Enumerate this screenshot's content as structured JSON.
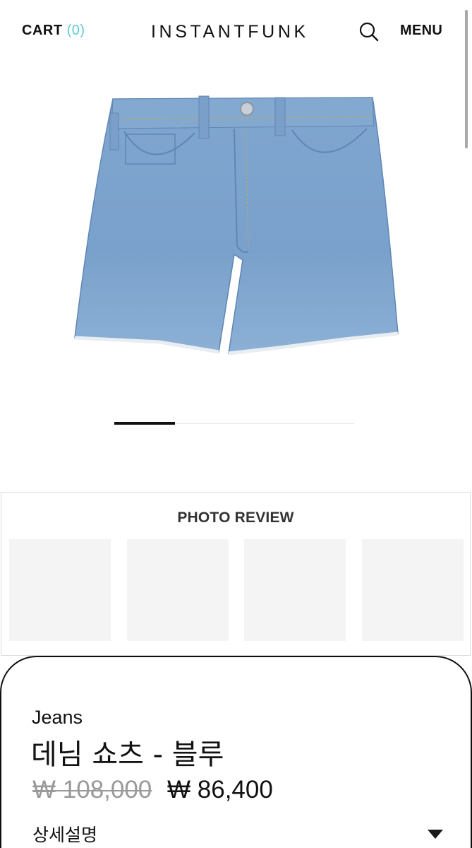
{
  "header": {
    "cart_label": "CART",
    "cart_count": "(0)",
    "brand": "INSTANTFUNK",
    "search_icon": "search-icon",
    "menu_label": "MENU",
    "cart_count_color": "#5fc8d2"
  },
  "product_image": {
    "alt": "denim shorts product photo",
    "denim_color": "#7ea3cc"
  },
  "carousel": {
    "active_index": 1,
    "total": 4
  },
  "photo_review": {
    "title": "PHOTO REVIEW",
    "thumbnails": 4
  },
  "product": {
    "category": "Jeans",
    "name": "데님 쇼츠 - 블루",
    "original_price": "₩ 108,000",
    "sale_price": "₩ 86,400",
    "details_label": "상세설명",
    "details_toggle_icon": "triangle-down-icon"
  }
}
